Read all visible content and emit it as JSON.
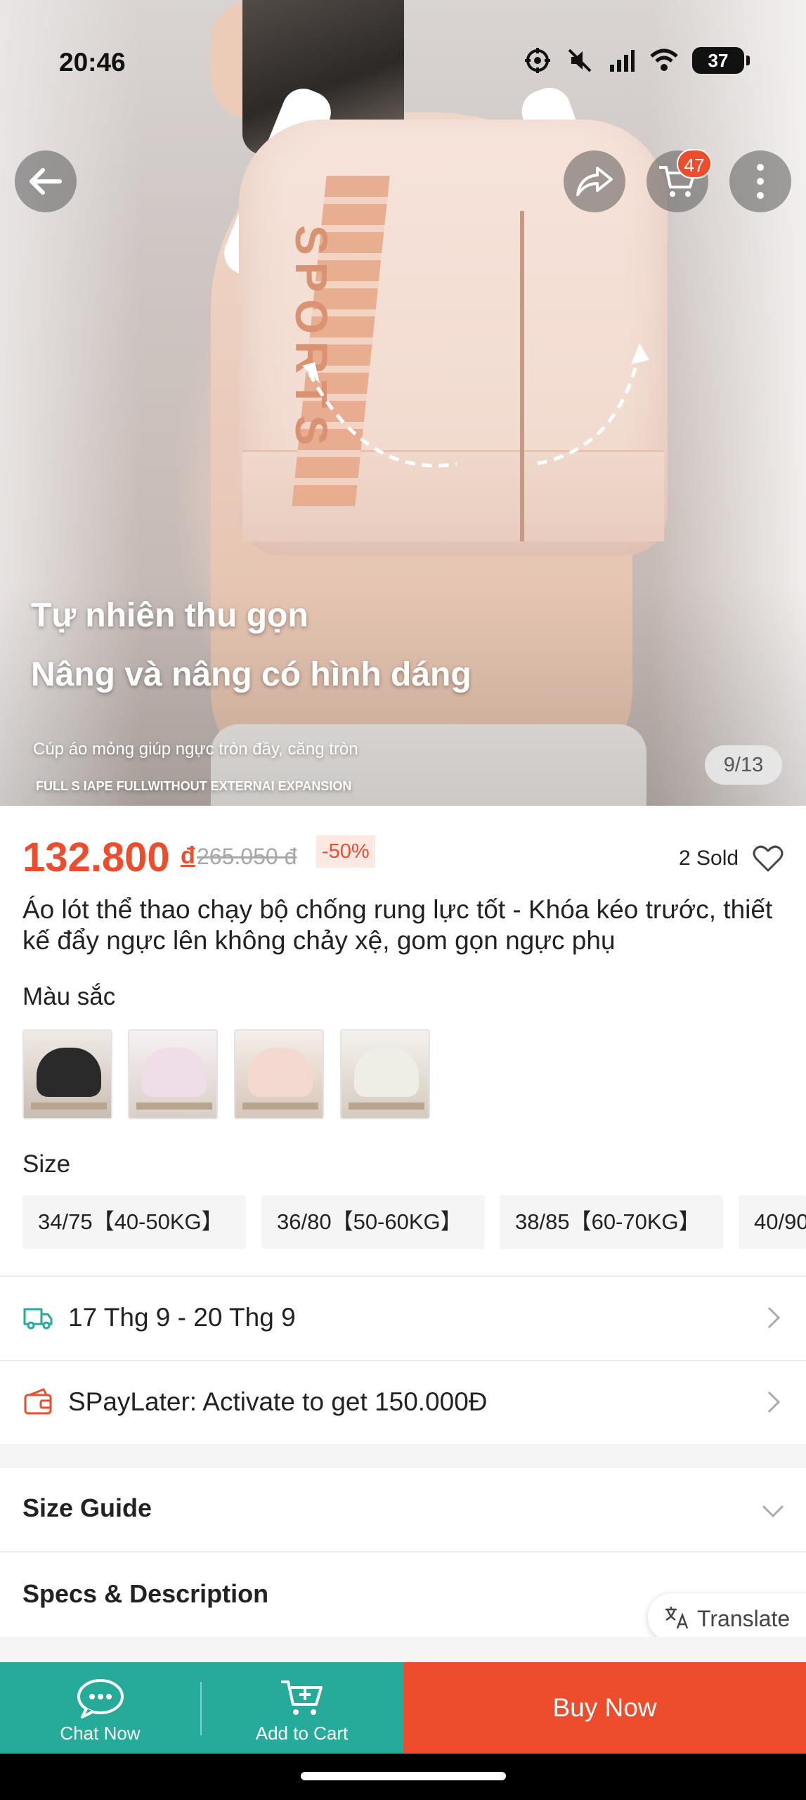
{
  "status_bar": {
    "time": "20:46",
    "battery": "37",
    "icons": [
      "location-lock-icon",
      "mute-icon",
      "signal-icon",
      "wifi-icon",
      "battery-icon"
    ]
  },
  "top_nav": {
    "icons": [
      "back-arrow-icon",
      "share-icon",
      "cart-icon",
      "more-icon"
    ],
    "cart_badge": "47"
  },
  "hero": {
    "overlay_line1": "Tự nhiên thu gọn",
    "overlay_line2": "Nâng và nâng có hình dáng",
    "overlay_line3": "Cúp áo mỏng giúp ngực tròn đầy, căng tròn",
    "overlay_line4": "FULL S IAPE FULLWITHOUT EXTERNAI EXPANSION",
    "product_print": "SPORTS",
    "counter": "9/13"
  },
  "product": {
    "price": "132.800",
    "currency": "đ",
    "original_price": "265.050 đ",
    "discount": "-50%",
    "sold": "2 Sold",
    "title": "Áo lót thể thao chạy bộ chống rung lực tốt - Khóa kéo trước, thiết kế đẩy ngực lên không chảy xệ, gom gọn ngực phụ"
  },
  "variations": {
    "color_label": "Màu sắc",
    "colors": [
      "black",
      "pink-purple",
      "pink-orange",
      "white-green"
    ],
    "size_label": "Size",
    "sizes": [
      "34/75【40-50KG】",
      "36/80【50-60KG】",
      "38/85【60-70KG】",
      "40/90"
    ]
  },
  "info_rows": {
    "shipping": "17 Thg 9 - 20 Thg 9",
    "spaylater": "SPayLater: Activate to get 150.000Đ"
  },
  "sections": {
    "size_guide": "Size Guide",
    "specs": "Specs & Description"
  },
  "translate": "Translate",
  "bottom_bar": {
    "chat_now": "Chat Now",
    "add_to_cart": "Add to Cart",
    "buy_now": "Buy Now"
  },
  "colors": {
    "primary": "#ee4d2d",
    "teal": "#26aa99"
  }
}
